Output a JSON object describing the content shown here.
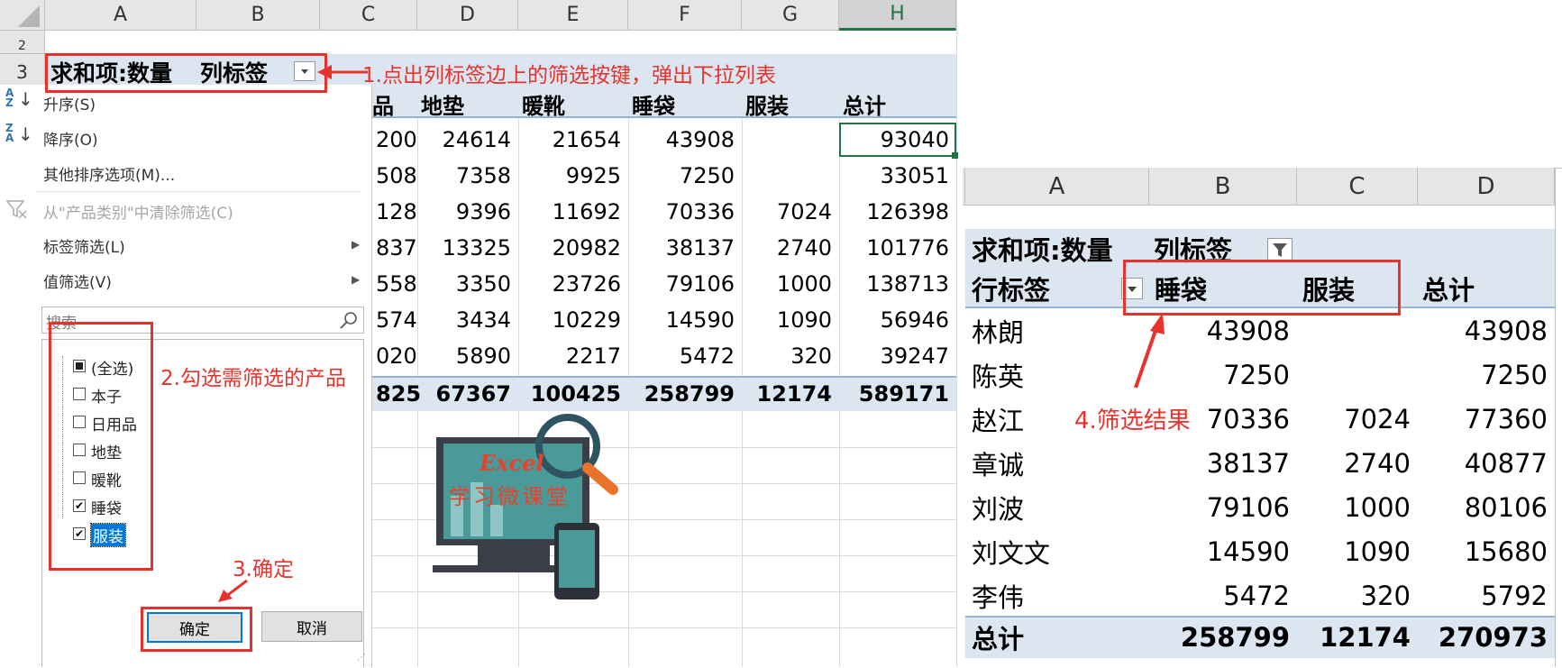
{
  "left_sheet": {
    "columns": [
      "A",
      "B",
      "C",
      "D",
      "E",
      "F",
      "G",
      "H"
    ],
    "row_numbers": [
      "2",
      "3"
    ],
    "pivot_header": {
      "sum_label": "求和项:数量",
      "col_label": "列标签"
    },
    "col_titles": [
      "品",
      "地垫",
      "暖靴",
      "睡袋",
      "服装",
      "总计"
    ],
    "rows": [
      [
        "200",
        "24614",
        "21654",
        "43908",
        "",
        "93040"
      ],
      [
        "508",
        "7358",
        "9925",
        "7250",
        "",
        "33051"
      ],
      [
        "128",
        "9396",
        "11692",
        "70336",
        "7024",
        "126398"
      ],
      [
        "837",
        "13325",
        "20982",
        "38137",
        "2740",
        "101776"
      ],
      [
        "558",
        "3350",
        "23726",
        "79106",
        "1000",
        "138713"
      ],
      [
        "574",
        "3434",
        "10229",
        "14590",
        "1090",
        "56946"
      ],
      [
        "020",
        "5890",
        "2217",
        "5472",
        "320",
        "39247"
      ]
    ],
    "total_row": [
      "825",
      "67367",
      "100425",
      "258799",
      "12174",
      "589171"
    ]
  },
  "filter_menu": {
    "sort_asc": "升序(S)",
    "sort_desc": "降序(O)",
    "more_sort": "其他排序选项(M)...",
    "clear_filter": "从\"产品类别\"中清除筛选(C)",
    "label_filter": "标签筛选(L)",
    "value_filter": "值筛选(V)",
    "search_placeholder": "搜索",
    "items": [
      {
        "label": "(全选)",
        "state": "partial"
      },
      {
        "label": "本子",
        "state": "unchecked"
      },
      {
        "label": "日用品",
        "state": "unchecked"
      },
      {
        "label": "地垫",
        "state": "unchecked"
      },
      {
        "label": "暖靴",
        "state": "unchecked"
      },
      {
        "label": "睡袋",
        "state": "checked"
      },
      {
        "label": "服装",
        "state": "checked"
      }
    ],
    "ok": "确定",
    "cancel": "取消"
  },
  "annotations": {
    "step1": "1.点出列标签边上的筛选按键，弹出下拉列表",
    "step2": "2.勾选需筛选的产品",
    "step3": "3.确定",
    "step4": "4.筛选结果"
  },
  "logo": {
    "title": "Excel",
    "subtitle": "学习微课堂"
  },
  "right_sheet": {
    "columns": [
      "A",
      "B",
      "C",
      "D"
    ],
    "pivot_header": {
      "sum_label": "求和项:数量",
      "col_label": "列标签"
    },
    "row_label": "行标签",
    "col_titles": [
      "睡袋",
      "服装",
      "总计"
    ],
    "rows": [
      {
        "name": "林朗",
        "values": [
          "43908",
          "",
          "43908"
        ]
      },
      {
        "name": "陈英",
        "values": [
          "7250",
          "",
          "7250"
        ]
      },
      {
        "name": "赵江",
        "values": [
          "70336",
          "7024",
          "77360"
        ]
      },
      {
        "name": "章诚",
        "values": [
          "38137",
          "2740",
          "40877"
        ]
      },
      {
        "name": "刘波",
        "values": [
          "79106",
          "1000",
          "80106"
        ]
      },
      {
        "name": "刘文文",
        "values": [
          "14590",
          "1090",
          "15680"
        ]
      },
      {
        "name": "李伟",
        "values": [
          "5472",
          "320",
          "5792"
        ]
      }
    ],
    "total": {
      "name": "总计",
      "values": [
        "258799",
        "12174",
        "270973"
      ]
    }
  },
  "colors": {
    "accent_red": "#e8322b",
    "pivot_blue": "#dce6f1",
    "excel_green": "#217346"
  }
}
